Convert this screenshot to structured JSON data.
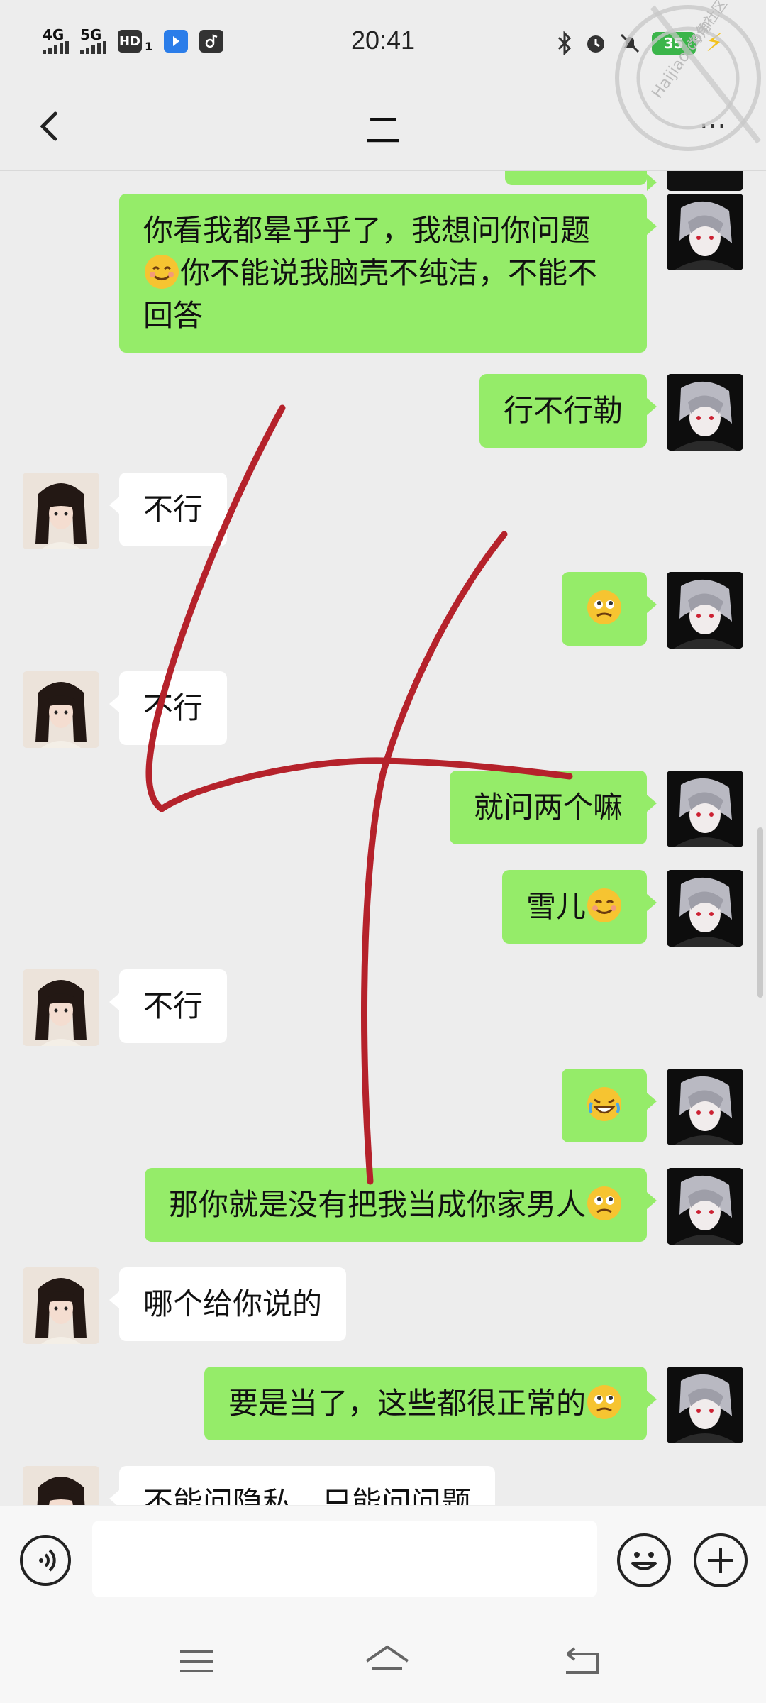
{
  "status_bar": {
    "network_1": "4G",
    "network_2": "5G",
    "hd_badge": "HD",
    "hd_sub": "1",
    "time": "20:41",
    "battery": "35"
  },
  "header": {
    "title": "二",
    "back_icon": "chevron-left-icon",
    "more_label": "..."
  },
  "messages": [
    {
      "from": "me",
      "text": "",
      "note": "partially cut off bubble at top"
    },
    {
      "from": "me",
      "text": "你看我都晕乎乎了，我想问你问题",
      "line2_after_emoji": "你不能说我脑壳不纯洁，不能不",
      "line3": "回答",
      "emoji": "smile"
    },
    {
      "from": "me",
      "text": "行不行勒"
    },
    {
      "from": "her",
      "text": "不行"
    },
    {
      "from": "me",
      "text": "",
      "emoji": "confused"
    },
    {
      "from": "her",
      "text": "不行"
    },
    {
      "from": "me",
      "text": "就问两个嘛"
    },
    {
      "from": "me",
      "text": "雪儿",
      "emoji": "smile"
    },
    {
      "from": "her",
      "text": "不行"
    },
    {
      "from": "me",
      "text": "",
      "emoji": "laugh-cry"
    },
    {
      "from": "me",
      "text": "那你就是没有把我当成你家男人",
      "emoji": "confused"
    },
    {
      "from": "her",
      "text": "哪个给你说的"
    },
    {
      "from": "me",
      "text": "要是当了，这些都很正常的",
      "emoji": "confused"
    },
    {
      "from": "her",
      "text": "不能问隐私，只能问问题"
    }
  ],
  "input_bar": {
    "placeholder": "",
    "voice_icon": "voice-icon",
    "emoji_icon": "emoji-icon",
    "plus_icon": "plus-icon"
  },
  "watermark": {
    "text1": "海角社区",
    "text2": "Haijiao.com"
  },
  "colors": {
    "my_bubble": "#95ec69",
    "her_bubble": "#ffffff",
    "background": "#ededed",
    "scribble": "#b5222b"
  }
}
